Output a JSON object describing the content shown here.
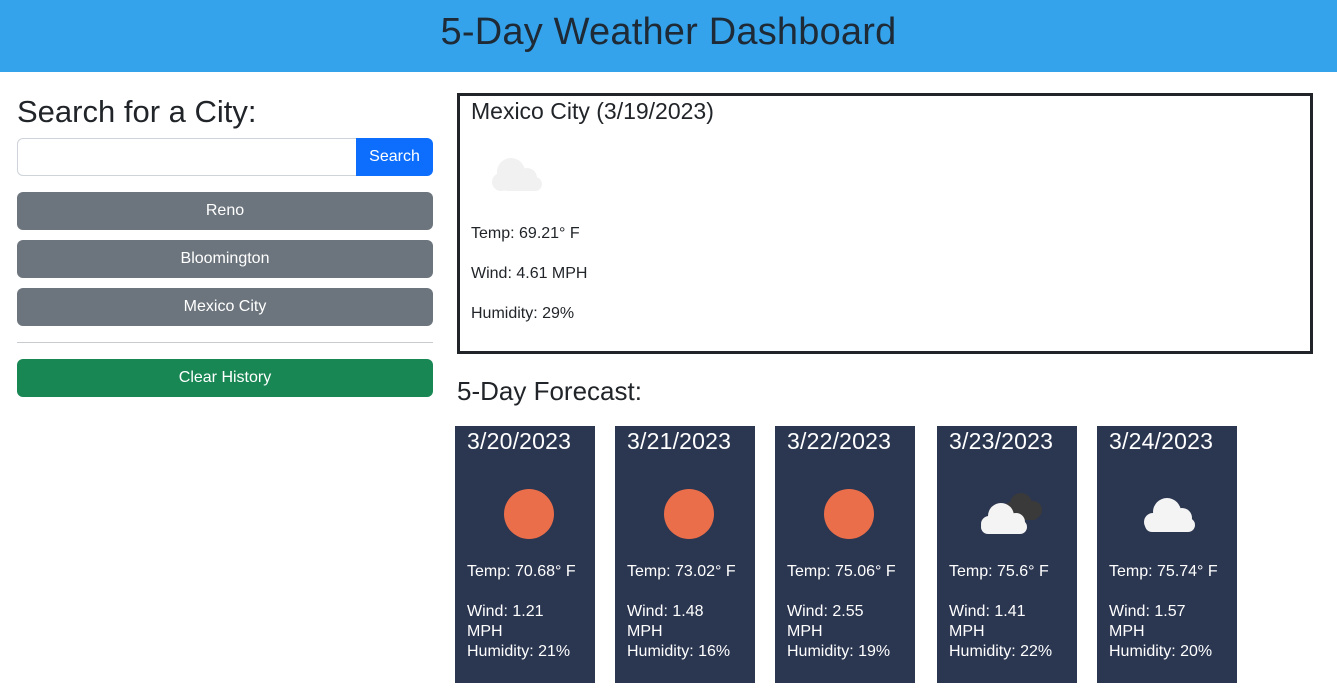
{
  "header": {
    "title": "5-Day Weather Dashboard"
  },
  "sidebar": {
    "heading": "Search for a City:",
    "search": {
      "value": "",
      "placeholder": "",
      "button_label": "Search"
    },
    "history": [
      {
        "label": "Reno"
      },
      {
        "label": "Bloomington"
      },
      {
        "label": "Mexico City"
      }
    ],
    "clear_label": "Clear History"
  },
  "current": {
    "title": "Mexico City (3/19/2023)",
    "icon": "cloud-icon",
    "temp": "Temp: 69.21° F",
    "wind": "Wind: 4.61 MPH",
    "humidity": "Humidity: 29%"
  },
  "forecast": {
    "title": "5-Day Forecast:",
    "days": [
      {
        "date": "3/20/2023",
        "icon": "sun-icon",
        "temp": "Temp: 70.68° F",
        "wind": "Wind: 1.21 MPH",
        "humidity": "Humidity: 21%"
      },
      {
        "date": "3/21/2023",
        "icon": "sun-icon",
        "temp": "Temp: 73.02° F",
        "wind": "Wind: 1.48 MPH",
        "humidity": "Humidity: 16%"
      },
      {
        "date": "3/22/2023",
        "icon": "sun-icon",
        "temp": "Temp: 75.06° F",
        "wind": "Wind: 2.55 MPH",
        "humidity": "Humidity: 19%"
      },
      {
        "date": "3/23/2023",
        "icon": "broken-clouds-icon",
        "temp": "Temp: 75.6° F",
        "wind": "Wind: 1.41 MPH",
        "humidity": "Humidity: 22%"
      },
      {
        "date": "3/24/2023",
        "icon": "cloud-icon",
        "temp": "Temp: 75.74° F",
        "wind": "Wind: 1.57 MPH",
        "humidity": "Humidity: 20%"
      }
    ]
  },
  "colors": {
    "header_bg": "#34a3eb",
    "search_button": "#0d6efd",
    "history_button": "#6c757d",
    "clear_button": "#198754",
    "card_bg": "#2b3650",
    "sun": "#eb6e4b"
  }
}
